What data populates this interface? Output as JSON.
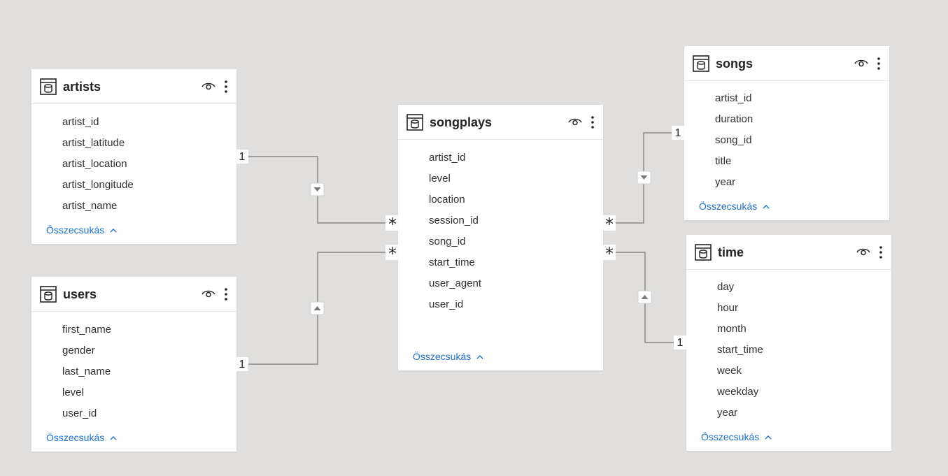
{
  "tables": {
    "artists": {
      "title": "artists",
      "fields": [
        "artist_id",
        "artist_latitude",
        "artist_location",
        "artist_longitude",
        "artist_name"
      ],
      "collapse_label": "Összecsukás"
    },
    "users": {
      "title": "users",
      "fields": [
        "first_name",
        "gender",
        "last_name",
        "level",
        "user_id"
      ],
      "collapse_label": "Összecsukás"
    },
    "songplays": {
      "title": "songplays",
      "fields": [
        "artist_id",
        "level",
        "location",
        "session_id",
        "song_id",
        "start_time",
        "user_agent",
        "user_id"
      ],
      "collapse_label": "Összecsukás"
    },
    "songs": {
      "title": "songs",
      "fields": [
        "artist_id",
        "duration",
        "song_id",
        "title",
        "year"
      ],
      "collapse_label": "Összecsukás"
    },
    "time": {
      "title": "time",
      "fields": [
        "day",
        "hour",
        "month",
        "start_time",
        "week",
        "weekday",
        "year"
      ],
      "collapse_label": "Összecsukás"
    }
  },
  "relationships": [
    {
      "from": "artists",
      "to": "songplays",
      "from_card": "1",
      "to_card": "*",
      "filter_direction": "down"
    },
    {
      "from": "users",
      "to": "songplays",
      "from_card": "1",
      "to_card": "*",
      "filter_direction": "up"
    },
    {
      "from": "songs",
      "to": "songplays",
      "from_card": "1",
      "to_card": "*",
      "filter_direction": "down"
    },
    {
      "from": "time",
      "to": "songplays",
      "from_card": "1",
      "to_card": "*",
      "filter_direction": "up"
    }
  ],
  "colors": {
    "canvas": "#e0dfdd",
    "card": "#ffffff",
    "link": "#1a6fc9",
    "line": "#8a8886",
    "text": "#323130"
  },
  "icons": {
    "table": "table-icon",
    "visibility": "eye-icon",
    "more": "more-options-icon",
    "collapse": "chevron-up-icon",
    "filter": "filter-direction-arrow-icon"
  }
}
